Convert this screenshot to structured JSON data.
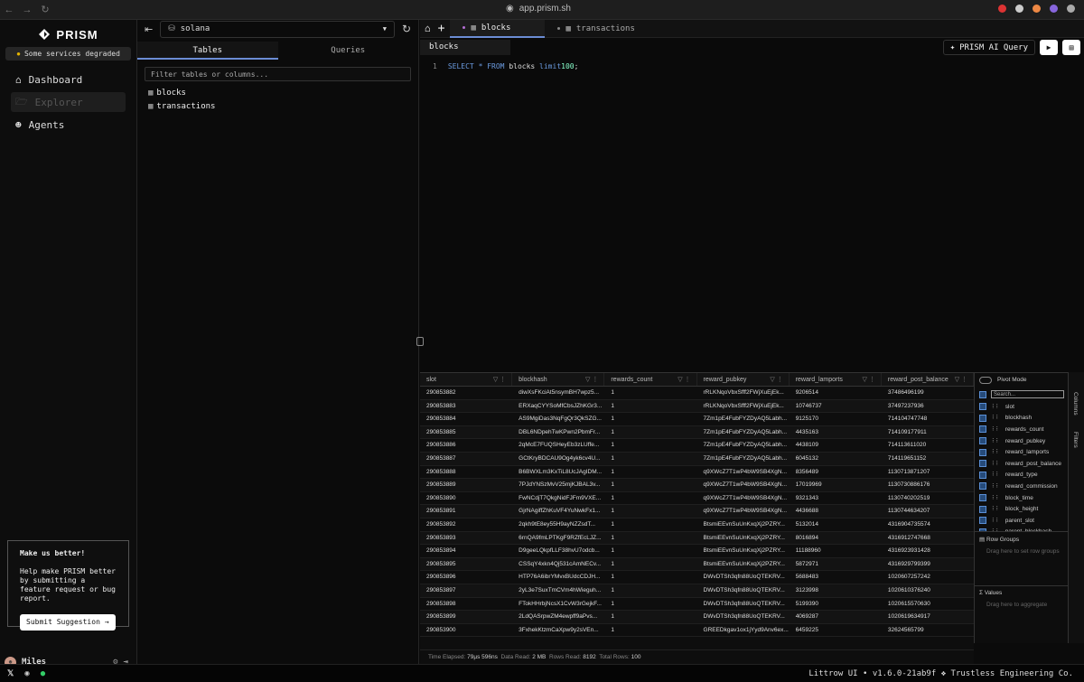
{
  "browser": {
    "url": "app.prism.sh"
  },
  "sidebar": {
    "brand": "PRISM",
    "status": "Some services degraded",
    "nav": [
      {
        "label": "Dashboard"
      },
      {
        "label": "Explorer"
      },
      {
        "label": "Agents"
      }
    ],
    "feedback": {
      "title": "Make us better!",
      "body": "Help make PRISM better by submitting a feature request or bug report.",
      "button": "Submit Suggestion"
    },
    "user": "Miles"
  },
  "explorer": {
    "database": "solana",
    "tabs": [
      "Tables",
      "Queries"
    ],
    "filter_placeholder": "Filter tables or columns...",
    "tables": [
      "blocks",
      "transactions"
    ]
  },
  "editor": {
    "tabs": [
      "blocks",
      "transactions"
    ],
    "query_name": "blocks",
    "ai_button": "PRISM AI Query",
    "line_number": "1",
    "sql": {
      "kw1": "SELECT",
      "star": "*",
      "kw2": "FROM",
      "table": "blocks",
      "kw3": "limit",
      "limit": "100",
      "end": ";"
    }
  },
  "grid": {
    "columns": [
      "slot",
      "blockhash",
      "rewards_count",
      "reward_pubkey",
      "reward_lamports",
      "reward_post_balance"
    ],
    "rows": [
      [
        "290853882",
        "diwXsFKciAt5nsymBH7wpz5...",
        "1",
        "rRLKNqoVbxSfff2FWjXuEjEk...",
        "9206514",
        "37486496199"
      ],
      [
        "290853883",
        "ERXaqCYYSoMfCbsJZhKGr3...",
        "1",
        "rRLKNqoVbxSfff2FWjXuEjEk...",
        "10746737",
        "37497237936"
      ],
      [
        "290853884",
        "AS9MgiDas3NqFgQr3QkSZG...",
        "1",
        "7Zm1pE4FubFYZDyAQ5Labh...",
        "9125170",
        "714104747748"
      ],
      [
        "290853885",
        "DBL6NDpehTwKPwn2PbmFr...",
        "1",
        "7Zm1pE4FubFYZDyAQ5Labh...",
        "4435163",
        "714109177911"
      ],
      [
        "290853886",
        "2qMcE7FUQSHeyEb3zLUffe...",
        "1",
        "7Zm1pE4FubFYZDyAQ5Labh...",
        "4438109",
        "714113611020"
      ],
      [
        "290853887",
        "GCtKryBDCAU9Og4yk6cv4U...",
        "1",
        "7Zm1pE4FubFYZDyAQ5Labh...",
        "6045132",
        "714119651152"
      ],
      [
        "290853888",
        "B6BWXLm3KxTiL8UcJAgIDM...",
        "1",
        "q9XWcZ7T1wP4bW9SB4XgN...",
        "8356489",
        "1130713871207"
      ],
      [
        "290853889",
        "7PJdYNSzMvV25mjKJBAL3v...",
        "1",
        "q9XWcZ7T1wP4bW9SB4XgN...",
        "17019969",
        "1130730886176"
      ],
      [
        "290853890",
        "FwNCdjT7QkgNidFJFm9VXE...",
        "1",
        "q9XWcZ7T1wP4bW9SB4XgN...",
        "9321343",
        "1130740202519"
      ],
      [
        "290853891",
        "GjrNAgiffZhKuVF4YuNwkFx1...",
        "1",
        "q9XWcZ7T1wP4bW9SB4XgN...",
        "4436688",
        "1130744634207"
      ],
      [
        "290853892",
        "2qkh9tE8ey55H9ayNZZsdT...",
        "1",
        "BtsmiEEvnSuUnKxqXj2PZRY...",
        "5132014",
        "4316904735574"
      ],
      [
        "290853893",
        "6rnQA9fmLPTKgF9RZfEcLJZ...",
        "1",
        "BtsmiEEvnSuUnKxqXj2PZRY...",
        "8016894",
        "4316912747668"
      ],
      [
        "290853894",
        "D9geeLQkpfLLF38hvU7odcb...",
        "1",
        "BtsmiEEvnSuUnKxqXj2PZRY...",
        "11188960",
        "4316923931428"
      ],
      [
        "290853895",
        "CSSqY4xkn4Qj531cAmNECv...",
        "1",
        "BtsmiEEvnSuUnKxqXj2PZRY...",
        "5872971",
        "4316929799399"
      ],
      [
        "290853896",
        "HTP76A6ibrYMvxBUdcCDJH...",
        "1",
        "DWvDTSh3qfn88UoQTEKRV...",
        "5688483",
        "1020607257242"
      ],
      [
        "290853897",
        "2yL3e7SuxTmCVm4hWieguh...",
        "1",
        "DWvDTSh3qfn88UoQTEKRV...",
        "3123998",
        "1020610376240"
      ],
      [
        "290853898",
        "FTokHHrbjNcsX1CvW3rGejkF...",
        "1",
        "DWvDTSh3qfn88UoQTEKRV...",
        "5199390",
        "1020615570630"
      ],
      [
        "290853899",
        "2LdQASrpwZM4ewpff9aPvs...",
        "1",
        "DWvDTSh3qfn88UoQTEKRV...",
        "4069287",
        "1020619634917"
      ],
      [
        "290853900",
        "3FxhekKtzmCaXpw9y2sVEn...",
        "1",
        "GREEDkgav1ox1jYyd9Anv6ex...",
        "6459225",
        "32624565799"
      ]
    ],
    "status": {
      "time_label": "Time Elapsed:",
      "time_value": "79µs 596ns",
      "data_label": "Data Read:",
      "data_value": "2 MB",
      "rows_label": "Rows Read:",
      "rows_value": "8192",
      "total_label": "Total Rows:",
      "total_value": "100"
    }
  },
  "column_panel": {
    "pivot_label": "Pivot Mode",
    "search_placeholder": "Search...",
    "columns": [
      "slot",
      "blockhash",
      "rewards_count",
      "reward_pubkey",
      "reward_lamports",
      "reward_post_balance",
      "reward_type",
      "reward_commission",
      "block_time",
      "block_height",
      "parent_slot",
      "parent_blockhash"
    ],
    "row_groups_title": "Row Groups",
    "row_groups_hint": "Drag here to set row groups",
    "values_title": "Values",
    "values_hint": "Drag here to aggregate",
    "side_tabs": [
      "Columns",
      "Filters"
    ]
  },
  "footer": {
    "version": "Littrow UI • v1.6.0-21ab9f ❖ Trustless Engineering Co."
  }
}
